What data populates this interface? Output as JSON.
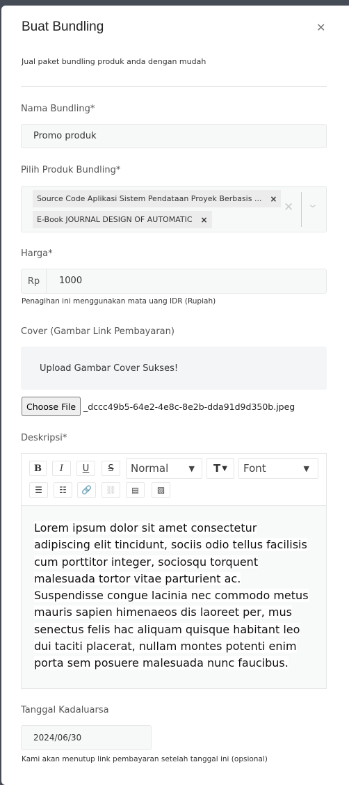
{
  "modal": {
    "title": "Buat Bundling",
    "subtitle": "Jual paket bundling produk anda dengan mudah",
    "close_icon": "close-icon"
  },
  "nama": {
    "label": "Nama Bundling*",
    "value": "Promo produk"
  },
  "produk": {
    "label": "Pilih Produk Bundling*",
    "selected": [
      "Source Code Aplikasi Sistem Pendataan Proyek Berbasis ...",
      "E-Book JOURNAL DESIGN OF AUTOMATIC"
    ]
  },
  "harga": {
    "label": "Harga*",
    "prefix": "Rp",
    "value": "1000",
    "hint": "Penagihan ini menggunakan mata uang IDR (Rupiah)"
  },
  "cover": {
    "label": "Cover (Gambar Link Pembayaran)",
    "status": "Upload Gambar Cover Sukses!",
    "button": "Choose File",
    "filename": "_dccc49b5-64e2-4e8c-8e2b-dda91d9d350b.jpeg"
  },
  "deskripsi": {
    "label": "Deskripsi*",
    "toolbar": {
      "heading": "Normal",
      "font": "Font"
    },
    "text": "Lorem ipsum dolor sit amet consectetur adipiscing elit tincidunt, sociis odio tellus facilisis cum porttitor integer, sociosqu torquent malesuada tortor vitae parturient ac. Suspendisse congue lacinia nec commodo metus mauris sapien himenaeos dis laoreet per, mus senectus felis hac aliquam quisque habitant leo dui taciti placerat, nullam montes potenti enim porta sem posuere malesuada nunc faucibus."
  },
  "tanggal": {
    "label": "Tanggal Kadaluarsa",
    "value": "2024/06/30",
    "hint": "Kami akan menutup link pembayaran setelah tanggal ini (opsional)"
  }
}
